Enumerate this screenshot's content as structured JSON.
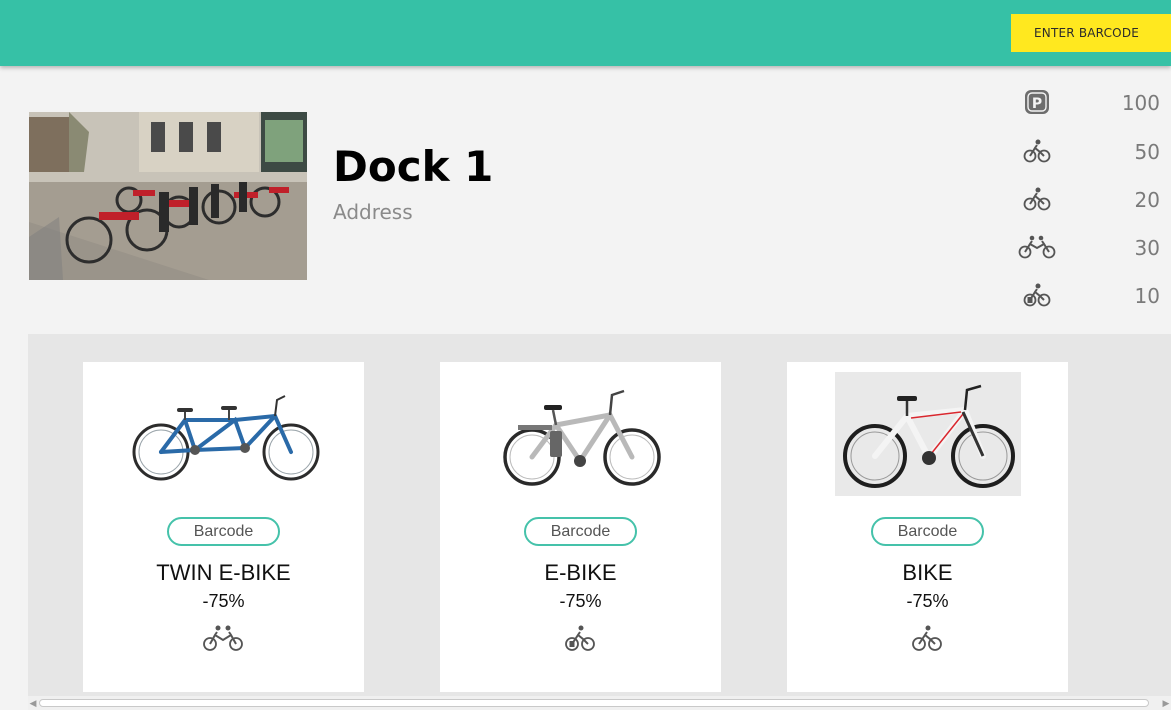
{
  "header": {
    "barcode_button_label": "ENTER BARCODE",
    "bar_color": "#36c1a6",
    "button_color": "#ffe81f"
  },
  "dock": {
    "title": "Dock 1",
    "address": "Address",
    "photo_icon": "dock-photo-image"
  },
  "stats": [
    {
      "icon": "parking-icon",
      "value": "100"
    },
    {
      "icon": "bike-icon",
      "value": "50"
    },
    {
      "icon": "bike-icon",
      "value": "20"
    },
    {
      "icon": "twin-bike-icon",
      "value": "30"
    },
    {
      "icon": "e-bike-icon",
      "value": "10"
    }
  ],
  "cards": [
    {
      "name": "TWIN E-BIKE",
      "discount": "-75%",
      "barcode_label": "Barcode",
      "type_icon": "twin-bike-icon"
    },
    {
      "name": "E-BIKE",
      "discount": "-75%",
      "barcode_label": "Barcode",
      "type_icon": "e-bike-icon"
    },
    {
      "name": "BIKE",
      "discount": "-75%",
      "barcode_label": "Barcode",
      "type_icon": "bike-icon"
    }
  ],
  "accent_color": "#45c2aa"
}
